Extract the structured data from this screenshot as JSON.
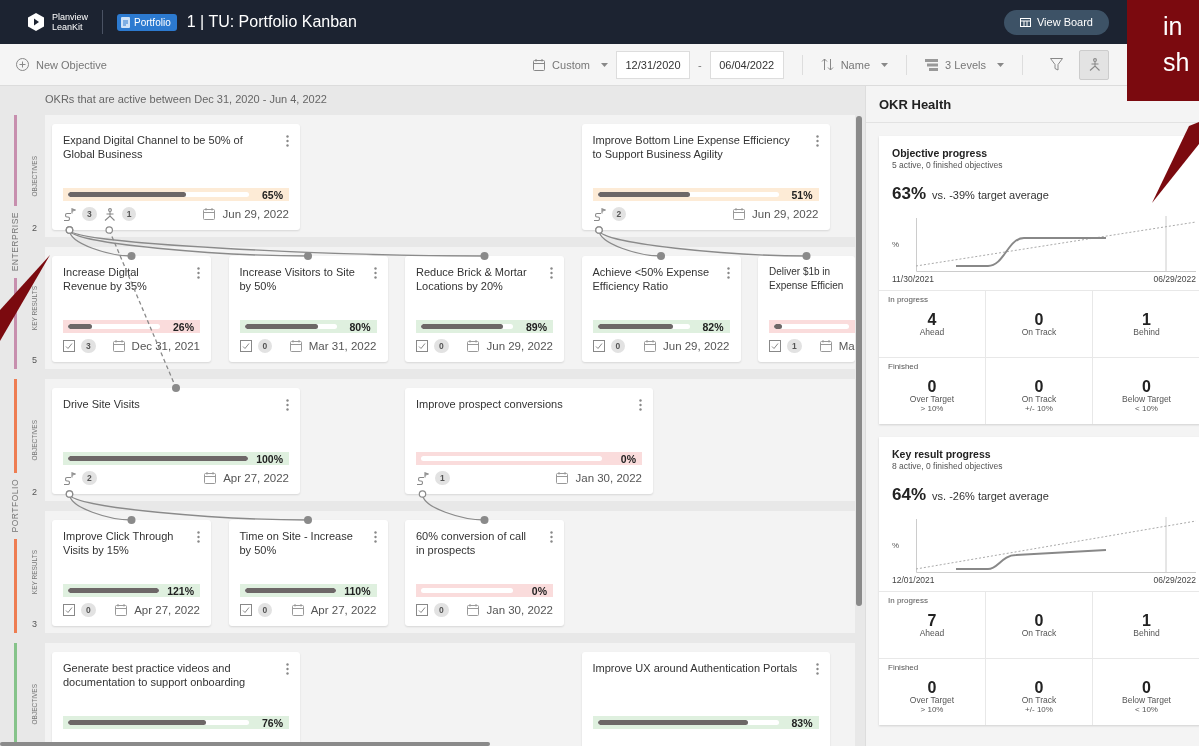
{
  "header": {
    "logo_lines": [
      "Planview",
      "LeanKit"
    ],
    "board_type": "Portfolio",
    "title": "1 | TU: Portfolio Kanban",
    "view_button": "View Board"
  },
  "toolbar": {
    "new_button": "New Objective",
    "date_preset": "Custom",
    "start_date": "12/31/2020",
    "separator": "-",
    "end_date": "06/04/2022",
    "sort": "Name",
    "levels": "3 Levels",
    "tools": [
      {
        "kind": "filter",
        "selected": false
      },
      {
        "kind": "person",
        "selected": true
      }
    ]
  },
  "board": {
    "info": "OKRs that are active between Dec 31, 2020 - Jun 4, 2022",
    "groups": [
      {
        "name": "ENTERPRISE",
        "color": "#c78fae",
        "lanes": [
          {
            "label": "OBJECTIVES",
            "count": "2"
          },
          {
            "label": "KEY RESULTS",
            "count": "5"
          }
        ],
        "objectives": [
          {
            "title": "Expand Digital Channel to be 50% of Global Business",
            "color": "#fdebd6",
            "level": 0.65,
            "percent": "65%",
            "badges": [
              {
                "kind": "key_results",
                "count": "3"
              },
              {
                "kind": "children",
                "count": "1"
              }
            ],
            "date": "Jun 29, 2022",
            "key_results": [
              {
                "title": "Increase Digital Revenue by 35%",
                "color": "#fadcdc",
                "level": 0.26,
                "percent": "26%",
                "checks": "3",
                "date": "Dec 31, 2021"
              },
              {
                "title": "Increase Visitors to Site by 50%",
                "color": "#dff0df",
                "level": 0.8,
                "percent": "80%",
                "checks": "0",
                "date": "Mar 31, 2022"
              },
              {
                "title": "Reduce Brick & Mortar Locations by 20%",
                "color": "#dff0df",
                "level": 0.89,
                "percent": "89%",
                "checks": "0",
                "date": "Jun 29, 2022"
              }
            ]
          },
          {
            "title": "Improve Bottom Line Expense Efficiency to Support Business Agility",
            "color": "#fdebd6",
            "level": 0.51,
            "percent": "51%",
            "badges": [
              {
                "kind": "key_results",
                "count": "2"
              }
            ],
            "date": "Jun 29, 2022",
            "key_results": [
              {
                "title": "Achieve <50% Expense Efficiency Ratio",
                "color": "#dff0df",
                "level": 0.82,
                "percent": "82%",
                "checks": "0",
                "date": "Jun 29, 2022"
              },
              {
                "title": "Deliver $1b in Expense Efficien",
                "color": "#fadcdc",
                "level": 0.1,
                "checks": "1",
                "date": "Ma",
                "truncated": true
              }
            ]
          }
        ]
      },
      {
        "name": "PORTFOLIO",
        "color": "#ee7d52",
        "lanes": [
          {
            "label": "OBJECTIVES",
            "count": "2"
          },
          {
            "label": "KEY RESULTS",
            "count": "3"
          }
        ],
        "objectives": [
          {
            "title": "Drive Site Visits",
            "color": "#dff0df",
            "level": 1,
            "percent": "100%",
            "badges": [
              {
                "kind": "key_results",
                "count": "2"
              }
            ],
            "date": "Apr 27, 2022",
            "key_results": [
              {
                "title": "Improve Click Through Visits by 15%",
                "color": "#dff0df",
                "level": 1,
                "percent": "121%",
                "checks": "0",
                "date": "Apr 27, 2022"
              },
              {
                "title": "Time on Site - Increase by 50%",
                "color": "#dff0df",
                "level": 1,
                "percent": "110%",
                "checks": "0",
                "date": "Apr 27, 2022"
              }
            ]
          },
          {
            "title": "Improve prospect conversions",
            "color": "#fadcdc",
            "level": 0,
            "percent": "0%",
            "badges": [
              {
                "kind": "key_results",
                "count": "1"
              }
            ],
            "date": "Jan 30, 2022",
            "key_results": [
              {
                "title": "60% conversion of call in prospects",
                "color": "#fadcdc",
                "level": 0,
                "percent": "0%",
                "checks": "0",
                "date": "Jan 30, 2022"
              }
            ]
          }
        ]
      },
      {
        "color": "#86c38a",
        "lanes": [
          {
            "label": "OBJECTIVES"
          }
        ],
        "objectives": [
          {
            "title": "Generate best practice videos and documentation to support onboarding",
            "color": "#dff0df",
            "level": 0.76,
            "percent": "76%"
          },
          {
            "title": "Improve UX around Authentication Portals",
            "color": "#dff0df",
            "level": 0.83,
            "percent": "83%"
          }
        ]
      }
    ]
  },
  "panel": {
    "title": "OKR Health",
    "cards": [
      {
        "title": "Objective progress",
        "subtitle": "5 active, 0 finished objectives",
        "percent": "63%",
        "comparison": "vs. -39% target average",
        "axis_label": "%",
        "start_date": "11/30/2021",
        "end_date": "06/29/2022",
        "sections": [
          {
            "label": "In progress",
            "stats": [
              {
                "value": "4",
                "label": "Ahead"
              },
              {
                "value": "0",
                "label": "On Track"
              },
              {
                "value": "1",
                "label": "Behind"
              }
            ]
          },
          {
            "label": "Finished",
            "stats": [
              {
                "value": "0",
                "label": "Over Target",
                "note": "> 10%"
              },
              {
                "value": "0",
                "label": "On Track",
                "note": "+/- 10%"
              },
              {
                "value": "0",
                "label": "Below Target",
                "note": "< 10%"
              }
            ]
          }
        ]
      },
      {
        "title": "Key result progress",
        "subtitle": "8 active, 0 finished objectives",
        "percent": "64%",
        "comparison": "vs. -26% target average",
        "axis_label": "%",
        "start_date": "12/01/2021",
        "end_date": "06/29/2022",
        "sections": [
          {
            "label": "In progress",
            "stats": [
              {
                "value": "7",
                "label": "Ahead"
              },
              {
                "value": "0",
                "label": "On Track"
              },
              {
                "value": "1",
                "label": "Behind"
              }
            ]
          },
          {
            "label": "Finished",
            "stats": [
              {
                "value": "0",
                "label": "Over Target",
                "note": "> 10%"
              },
              {
                "value": "0",
                "label": "On Track",
                "note": "+/- 10%"
              },
              {
                "value": "0",
                "label": "Below Target",
                "note": "< 10%"
              }
            ]
          }
        ]
      }
    ]
  },
  "callout": {
    "lines": [
      "in",
      "sh"
    ]
  }
}
